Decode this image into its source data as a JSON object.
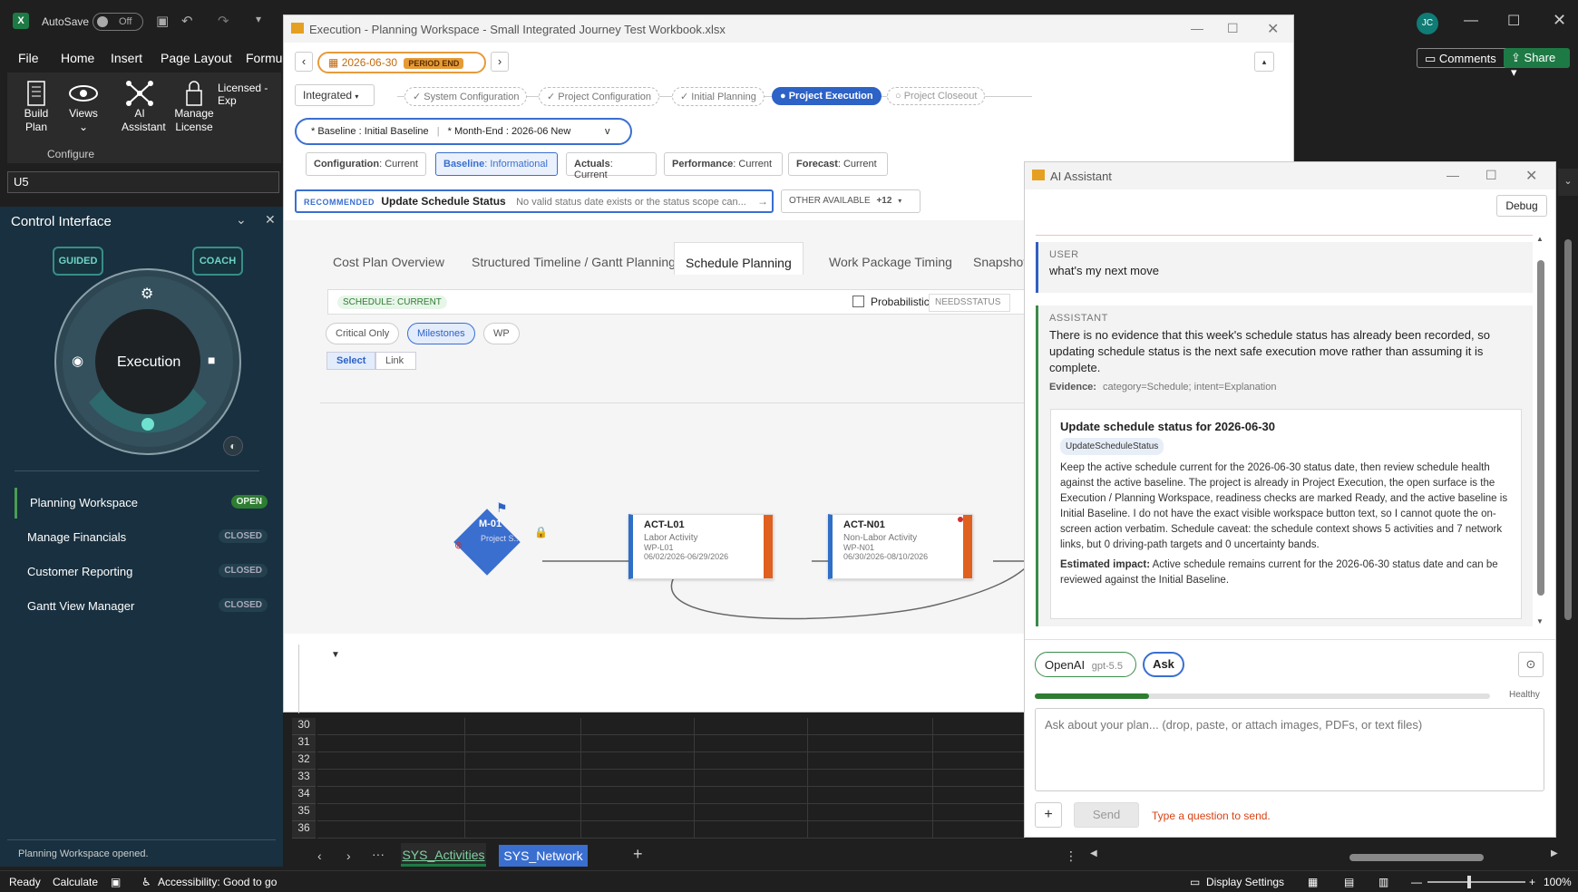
{
  "excel": {
    "autosave": "AutoSave",
    "autosave_state": "Off",
    "user_initials": "JC",
    "menu": [
      "File",
      "Home",
      "Insert",
      "Page Layout",
      "Formul"
    ],
    "comments": "Comments",
    "share": "Share",
    "ribbon": {
      "build_plan": "Build Plan",
      "views": "Views",
      "ai_assistant": "AI Assistant",
      "manage_license": "Manage License",
      "licensed": "Licensed - Exp",
      "group": "Configure"
    },
    "namebox": "U5"
  },
  "control": {
    "title": "Control Interface",
    "guided": "GUIDED",
    "coach": "COACH",
    "mode": "Execution",
    "workspaces": [
      {
        "label": "Planning Workspace",
        "status": "OPEN"
      },
      {
        "label": "Manage Financials",
        "status": "CLOSED"
      },
      {
        "label": "Customer Reporting",
        "status": "CLOSED"
      },
      {
        "label": "Gantt View Manager",
        "status": "CLOSED"
      }
    ],
    "footer": "Planning Workspace opened."
  },
  "workspace": {
    "title": "Execution - Planning Workspace - Small Integrated Journey Test Workbook.xlsx",
    "date": "2026-06-30",
    "period": "PERIOD END",
    "view": "Integrated",
    "stages": [
      "✓ System Configuration",
      "✓ Project Configuration",
      "✓ Initial Planning",
      "● Project Execution",
      "○ Project Closeout"
    ],
    "baseline_label": "* Baseline : Initial Baseline",
    "monthend_label": "* Month-End : 2026-06 New",
    "monthend_caret": "v",
    "chips": [
      {
        "k": "Configuration",
        "v": "Current"
      },
      {
        "k": "Baseline",
        "v": "Informational"
      },
      {
        "k": "Actuals",
        "v": "Current"
      },
      {
        "k": "Performance",
        "v": "Current"
      },
      {
        "k": "Forecast",
        "v": "Current"
      }
    ],
    "recommended_tag": "RECOMMENDED",
    "recommended_title": "Update Schedule Status",
    "recommended_desc": "No valid status date exists or the status scope can...",
    "other_available": "OTHER AVAILABLE",
    "other_count": "+12",
    "tabs": [
      "Cost Plan Overview",
      "Structured Timeline / Gantt Planning",
      "Schedule Planning",
      "Work Package Timing",
      "Snapshot M"
    ],
    "schedule_badge": "SCHEDULE: CURRENT",
    "probabilistic": "Probabilistic",
    "needsstatus": "NEEDSSTATUS",
    "filters": [
      "Critical Only",
      "Milestones",
      "WP"
    ],
    "modes": [
      "Select",
      "Link"
    ],
    "nodes": [
      {
        "id": "M-01",
        "name": "Project S..."
      },
      {
        "id": "ACT-L01",
        "type": "Labor Activity",
        "wp": "WP-L01",
        "dates": "06/02/2026-06/29/2026"
      },
      {
        "id": "ACT-N01",
        "type": "Non-Labor Activity",
        "wp": "WP-N01",
        "dates": "06/30/2026-08/10/2026"
      }
    ]
  },
  "grid": {
    "rows": [
      "30",
      "31",
      "32",
      "33",
      "34",
      "35",
      "36"
    ]
  },
  "sheets": [
    "SYS_Activities",
    "SYS_Network"
  ],
  "ai": {
    "title": "AI Assistant",
    "debug": "Debug",
    "user_role": "USER",
    "user_text": "what's my next move",
    "assistant_role": "ASSISTANT",
    "assistant_text": "There is no evidence that this week's schedule status has already been recorded, so updating schedule status is the next safe execution move rather than assuming it is complete.",
    "evidence_label": "Evidence:",
    "evidence_value": "category=Schedule; intent=Explanation",
    "card_title": "Update schedule status for 2026-06-30",
    "card_tag": "UpdateScheduleStatus",
    "card_body": "Keep the active schedule current for the 2026-06-30 status date, then review schedule health against the active baseline. The project is already in Project Execution, the open surface is the Execution / Planning Workspace, readiness checks are marked Ready, and the active baseline is Initial Baseline. I do not have the exact visible workspace button text, so I cannot quote the on-screen action verbatim. Schedule caveat: the schedule context shows 5 activities and 7 network links, but 0 driving-path targets and 0 uncertainty bands.",
    "impact_label": "Estimated impact:",
    "impact_value": "Active schedule remains current for the 2026-06-30 status date and can be reviewed against the Initial Baseline.",
    "provider": "OpenAI",
    "model": "gpt-5.5",
    "ask": "Ask",
    "health": "Healthy",
    "health_level": 0.25,
    "placeholder": "Ask about your plan... (drop, paste, or attach images, PDFs, or text files)",
    "send": "Send",
    "hint": "Type a question to send."
  },
  "status": {
    "ready": "Ready",
    "calculate": "Calculate",
    "accessibility": "Accessibility: Good to go",
    "display": "Display Settings",
    "zoom": "100%"
  }
}
